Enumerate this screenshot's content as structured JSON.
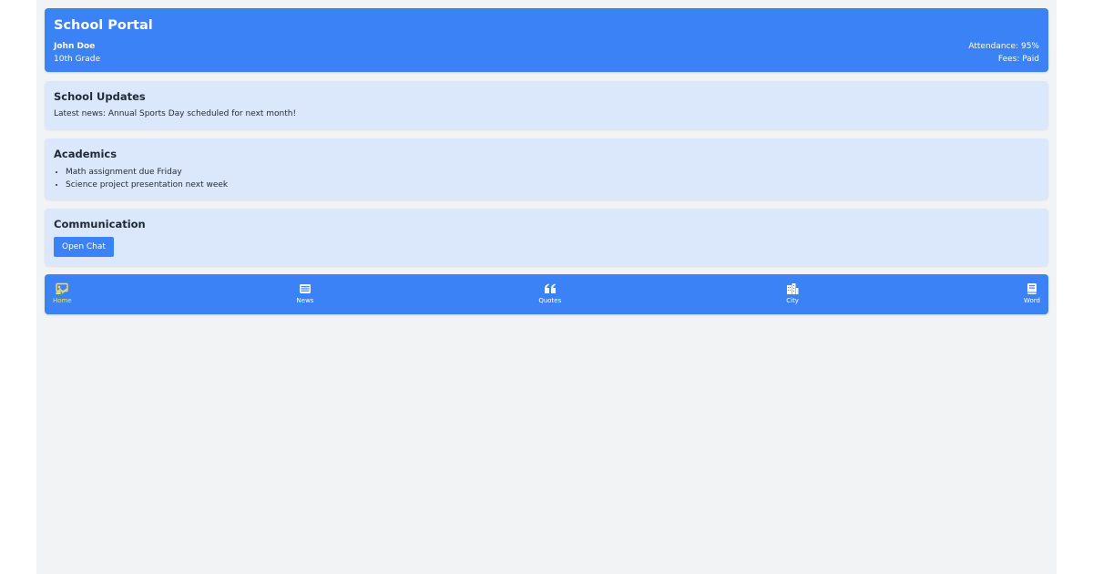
{
  "header": {
    "title": "School Portal",
    "student_name": "John Doe",
    "grade": "10th Grade",
    "attendance": "Attendance: 95%",
    "fees": "Fees: Paid"
  },
  "updates": {
    "title": "School Updates",
    "text": "Latest news: Annual Sports Day scheduled for next month!"
  },
  "academics": {
    "title": "Academics",
    "items": [
      "Math assignment due Friday",
      "Science project presentation next week"
    ]
  },
  "communication": {
    "title": "Communication",
    "button_label": "Open Chat"
  },
  "nav": {
    "items": [
      {
        "label": "Home",
        "icon": "home-icon",
        "active": true
      },
      {
        "label": "News",
        "icon": "news-icon"
      },
      {
        "label": "Quotes",
        "icon": "quote-icon"
      },
      {
        "label": "City",
        "icon": "city-icon"
      },
      {
        "label": "Word",
        "icon": "book-icon"
      }
    ],
    "active_color": "#fde047"
  },
  "colors": {
    "primary": "#3b82f6",
    "card_bg": "#dbe8fc",
    "page_bg": "#f2f3f5"
  }
}
